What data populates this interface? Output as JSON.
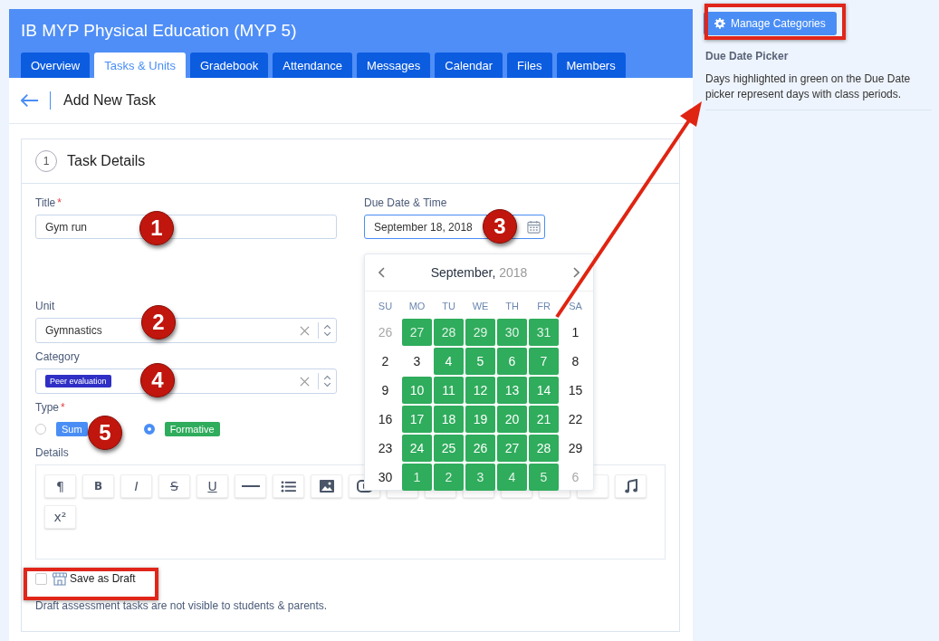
{
  "course": {
    "title": "IB MYP Physical Education (MYP 5)"
  },
  "tabs": [
    {
      "label": "Overview",
      "selected": false
    },
    {
      "label": "Tasks & Units",
      "selected": true
    },
    {
      "label": "Gradebook",
      "selected": false
    },
    {
      "label": "Attendance",
      "selected": false
    },
    {
      "label": "Messages",
      "selected": false
    },
    {
      "label": "Calendar",
      "selected": false
    },
    {
      "label": "Files",
      "selected": false
    },
    {
      "label": "Members",
      "selected": false
    }
  ],
  "page_title": "Add New Task",
  "section": {
    "step": "1",
    "title": "Task Details"
  },
  "form": {
    "title": {
      "label": "Title",
      "required_mark": "*",
      "value": "Gym run"
    },
    "due": {
      "label": "Due Date & Time",
      "value": "September 18, 2018"
    },
    "unit": {
      "label": "Unit",
      "value": "Gymnastics"
    },
    "category": {
      "label": "Category",
      "value": "Peer evaluation"
    },
    "type": {
      "label": "Type",
      "required_mark": "*",
      "options": [
        {
          "label": "Sum",
          "selected": false,
          "color": "#4a8ef5"
        },
        {
          "label": "Formative",
          "selected": true,
          "color": "#2fac5c"
        }
      ]
    },
    "details": {
      "label": "Details"
    },
    "toolbar": [
      {
        "kind": "text",
        "label": "¶"
      },
      {
        "kind": "bold",
        "label": "B"
      },
      {
        "kind": "italic",
        "label": "I"
      },
      {
        "kind": "strike",
        "label": "S"
      },
      {
        "kind": "underline",
        "label": "U"
      },
      {
        "kind": "rule"
      },
      {
        "kind": "list"
      },
      {
        "kind": "image"
      },
      {
        "kind": "video"
      },
      {
        "kind": "covered"
      },
      {
        "kind": "covered"
      },
      {
        "kind": "covered"
      },
      {
        "kind": "covered"
      },
      {
        "kind": "covered"
      },
      {
        "kind": "covered"
      },
      {
        "kind": "music"
      },
      {
        "kind": "text",
        "label": "x²"
      }
    ],
    "draft": {
      "label": "Save as Draft",
      "checked": false,
      "note": "Draft assessment tasks are not visible to students & parents."
    }
  },
  "calendar": {
    "month": "September,",
    "year": "2018",
    "weekdays": [
      "SU",
      "MO",
      "TU",
      "WE",
      "TH",
      "FR",
      "SA"
    ],
    "days": [
      {
        "day": "26",
        "muted": true,
        "class_day": false
      },
      {
        "day": "27",
        "muted": true,
        "class_day": true
      },
      {
        "day": "28",
        "muted": true,
        "class_day": true
      },
      {
        "day": "29",
        "muted": true,
        "class_day": true
      },
      {
        "day": "30",
        "muted": true,
        "class_day": true
      },
      {
        "day": "31",
        "muted": true,
        "class_day": true
      },
      {
        "day": "1",
        "muted": false,
        "class_day": false
      },
      {
        "day": "2",
        "muted": false,
        "class_day": false
      },
      {
        "day": "3",
        "muted": false,
        "class_day": false
      },
      {
        "day": "4",
        "muted": false,
        "class_day": true
      },
      {
        "day": "5",
        "muted": false,
        "class_day": true
      },
      {
        "day": "6",
        "muted": false,
        "class_day": true
      },
      {
        "day": "7",
        "muted": false,
        "class_day": true
      },
      {
        "day": "8",
        "muted": false,
        "class_day": false
      },
      {
        "day": "9",
        "muted": false,
        "class_day": false
      },
      {
        "day": "10",
        "muted": false,
        "class_day": true
      },
      {
        "day": "11",
        "muted": false,
        "class_day": true
      },
      {
        "day": "12",
        "muted": false,
        "class_day": true
      },
      {
        "day": "13",
        "muted": false,
        "class_day": true
      },
      {
        "day": "14",
        "muted": false,
        "class_day": true
      },
      {
        "day": "15",
        "muted": false,
        "class_day": false
      },
      {
        "day": "16",
        "muted": false,
        "class_day": false
      },
      {
        "day": "17",
        "muted": false,
        "class_day": true
      },
      {
        "day": "18",
        "muted": false,
        "class_day": true
      },
      {
        "day": "19",
        "muted": false,
        "class_day": true
      },
      {
        "day": "20",
        "muted": false,
        "class_day": true
      },
      {
        "day": "21",
        "muted": false,
        "class_day": true
      },
      {
        "day": "22",
        "muted": false,
        "class_day": false
      },
      {
        "day": "23",
        "muted": false,
        "class_day": false
      },
      {
        "day": "24",
        "muted": false,
        "class_day": true
      },
      {
        "day": "25",
        "muted": false,
        "class_day": true
      },
      {
        "day": "26",
        "muted": false,
        "class_day": true
      },
      {
        "day": "27",
        "muted": false,
        "class_day": true
      },
      {
        "day": "28",
        "muted": false,
        "class_day": true
      },
      {
        "day": "29",
        "muted": false,
        "class_day": false
      },
      {
        "day": "30",
        "muted": false,
        "class_day": false
      },
      {
        "day": "1",
        "muted": true,
        "class_day": true
      },
      {
        "day": "2",
        "muted": true,
        "class_day": true
      },
      {
        "day": "3",
        "muted": true,
        "class_day": true
      },
      {
        "day": "4",
        "muted": true,
        "class_day": true
      },
      {
        "day": "5",
        "muted": true,
        "class_day": true
      },
      {
        "day": "6",
        "muted": true,
        "class_day": false
      }
    ]
  },
  "sidebar": {
    "button": "Manage Categories",
    "heading": "Due Date Picker",
    "text": "Days highlighted in green on the Due Date picker represent days with class periods."
  },
  "annotations": [
    {
      "label": "1"
    },
    {
      "label": "2"
    },
    {
      "label": "3"
    },
    {
      "label": "4"
    },
    {
      "label": "5"
    }
  ]
}
